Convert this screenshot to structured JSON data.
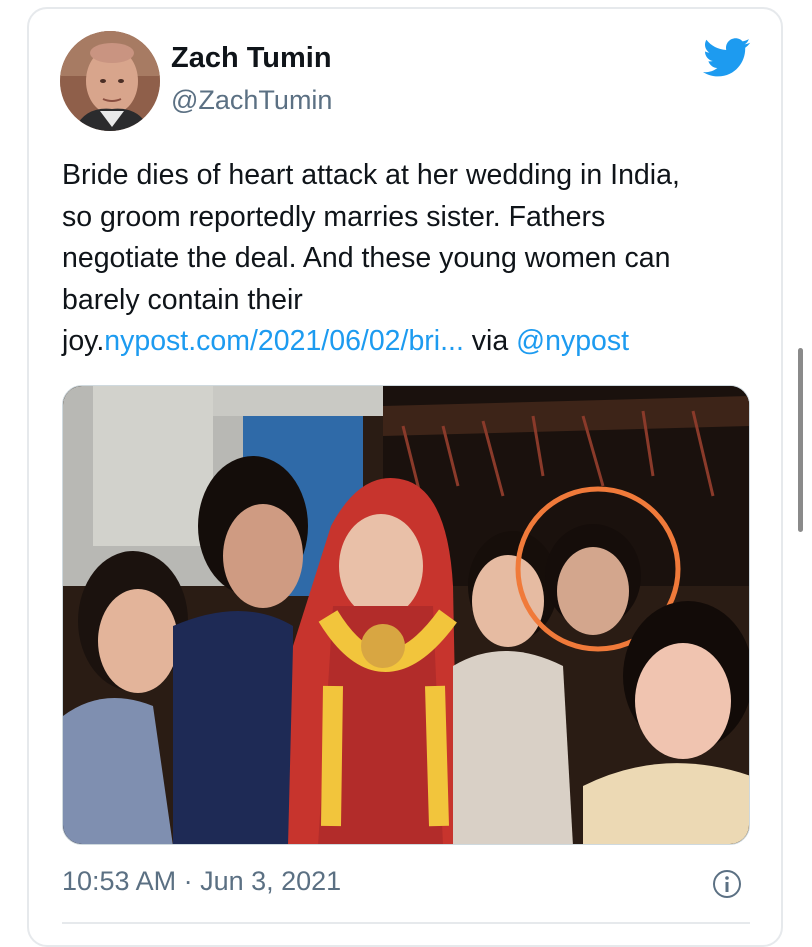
{
  "tweet": {
    "author_name": "Zach Tumin",
    "author_handle": "@ZachTumin",
    "text_lines": [
      "Bride dies of heart attack at her wedding in India,",
      "so groom reportedly marries sister. Fathers",
      "negotiate the deal. And these young women can",
      "barely contain their"
    ],
    "text_joy": "joy.",
    "link_text": "nypost.com/2021/06/02/bri...",
    "via_text": " via ",
    "mention": "@nypost",
    "timestamp": "10:53 AM · Jun 3, 2021"
  },
  "icons": {
    "brand": "twitter-bird-icon",
    "info": "info-icon"
  },
  "colors": {
    "link": "#1d9bf0",
    "secondary_text": "#5b7083",
    "highlight_circle": "#f07a3a"
  }
}
